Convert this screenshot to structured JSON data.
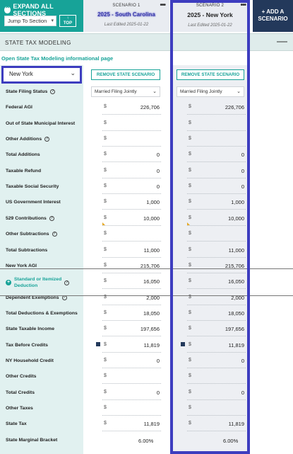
{
  "header": {
    "expand_label": "EXPAND ALL SECTIONS",
    "jump_label": "Jump To Section",
    "top_label_line1": "↑",
    "top_label_line2": "TOP",
    "add_scenario_line1": "+ ADD A",
    "add_scenario_line2": "SCENARIO"
  },
  "scenarios": [
    {
      "number": "SCENARIO 1",
      "name": "2025 - South Carolina",
      "edited": "Last Edited 2025-01-22",
      "remove_label": "REMOVE STATE SCENARIO",
      "filing_status": "Married Filing Jointly"
    },
    {
      "number": "SCENARIO 2",
      "name": "2025 - New York",
      "edited": "Last Edited 2025-01-22",
      "remove_label": "REMOVE STATE SCENARIO",
      "filing_status": "Married Filing Jointly"
    }
  ],
  "section": {
    "title": "STATE TAX MODELING",
    "collapse_icon": "minus-icon"
  },
  "open_link": "Open State Tax Modeling informational page",
  "state_select": "New York",
  "rows": [
    {
      "label": "State Filing Status",
      "info": true,
      "type": "select"
    },
    {
      "label": "Federal AGI",
      "s1": "226,706",
      "s2": "226,706"
    },
    {
      "label": "Out of State Municipal Interest",
      "s1": "",
      "s2": ""
    },
    {
      "label": "Other Additions",
      "info": true,
      "s1": "",
      "s2": ""
    },
    {
      "label": "Total Additions",
      "s1": "0",
      "s2": "0"
    },
    {
      "label": "Taxable Refund",
      "s1": "0",
      "s2": "0"
    },
    {
      "label": "Taxable Social Security",
      "s1": "0",
      "s2": "0"
    },
    {
      "label": "US Government Interest",
      "s1": "1,000",
      "s2": "1,000"
    },
    {
      "label": "529 Contributions",
      "info": true,
      "s1": "10,000",
      "s2": "10,000",
      "flag": true
    },
    {
      "label": "Other Subtractions",
      "info": true,
      "s1": "",
      "s2": ""
    },
    {
      "label": "Total Subtractions",
      "s1": "11,000",
      "s2": "11,000"
    },
    {
      "label": "New York AGI",
      "s1": "215,706",
      "s2": "215,706"
    },
    {
      "label": "Standard or Itemized Deduction",
      "info": true,
      "s1": "16,050",
      "s2": "16,050",
      "special": true
    },
    {
      "label": "Dependent Exemptions",
      "info": true,
      "s1": "2,000",
      "s2": "2,000"
    },
    {
      "label": "Total Deductions & Exemptions",
      "s1": "18,050",
      "s2": "18,050"
    },
    {
      "label": "State Taxable Income",
      "s1": "197,656",
      "s2": "197,656"
    },
    {
      "label": "Tax Before Credits",
      "s1": "11,819",
      "s2": "11,819",
      "calc": true
    },
    {
      "label": "NY Household Credit",
      "s1": "0",
      "s2": "0"
    },
    {
      "label": "Other Credits",
      "s1": "",
      "s2": ""
    },
    {
      "label": "Total Credits",
      "s1": "0",
      "s2": "0"
    },
    {
      "label": "Other Taxes",
      "s1": "",
      "s2": ""
    },
    {
      "label": "State Tax",
      "s1": "11,819",
      "s2": "11,819"
    },
    {
      "label": "State Marginal Bracket",
      "s1": "6.00%",
      "s2": "6.00%",
      "pct": true
    }
  ],
  "special_label_line1": "Standard or Itemized",
  "special_label_line2": "Deduction",
  "currency": "$"
}
